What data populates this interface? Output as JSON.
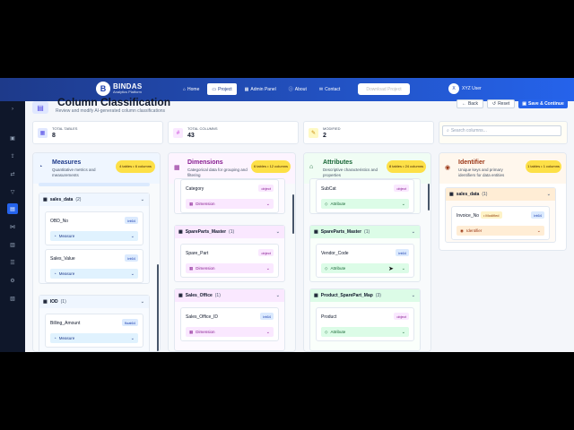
{
  "app": {
    "name": "BINDAS",
    "tagline": "Analytics Platform",
    "logo_letter": "B"
  },
  "nav": [
    {
      "label": "Home",
      "icon": "home-icon",
      "active": false
    },
    {
      "label": "Project",
      "icon": "folder-icon",
      "active": true
    },
    {
      "label": "Admin Panel",
      "icon": "grid-icon",
      "active": false
    },
    {
      "label": "About",
      "icon": "info-icon",
      "active": false
    },
    {
      "label": "Contact",
      "icon": "mail-icon",
      "active": false
    }
  ],
  "download_label": "Download Project",
  "user": {
    "name": "XYZ User",
    "initials": "X"
  },
  "page": {
    "title": "Column Classification",
    "subtitle": "Review and modify AI-generated column classifications"
  },
  "actions": {
    "back": "Back",
    "reset": "Reset",
    "save": "Save & Continue"
  },
  "stats": [
    {
      "label": "TOTAL TABLES",
      "value": "8",
      "icon": "table-icon",
      "color": "#4f46e5",
      "bg": "#e0e7ff"
    },
    {
      "label": "TOTAL COLUMNS",
      "value": "43",
      "icon": "hash-icon",
      "color": "#c026d3",
      "bg": "#fae8ff"
    },
    {
      "label": "MODIFIED",
      "value": "2",
      "icon": "edit-icon",
      "color": "#ca8a04",
      "bg": "#fef9c3"
    }
  ],
  "search": {
    "placeholder": "Search columns..."
  },
  "columns": {
    "measures": {
      "title": "Measures",
      "desc": "Quantitative metrics and measurements",
      "badge": "4 tables • 6 columns",
      "color": "#1e3a8a",
      "bg": "#eff6ff"
    },
    "dimensions": {
      "title": "Dimensions",
      "desc": "Categorical data for grouping and filtering",
      "badge": "6 tables • 12 columns",
      "color": "#86198f",
      "bg": "#fdf4ff"
    },
    "attributes": {
      "title": "Attributes",
      "desc": "Descriptive characteristics and properties",
      "badge": "8 tables • 24 columns",
      "color": "#166534",
      "bg": "#f0fdf4"
    },
    "identifier": {
      "title": "Identifier",
      "desc": "Unique keys and primary identifiers for data entities",
      "badge": "1 tables • 1 columns",
      "color": "#9a3412",
      "bg": "#fff7ed"
    }
  },
  "measures_groups": [
    {
      "name": "sales_data",
      "count": "(2)",
      "items": [
        {
          "name": "OBD_No",
          "dtype": "int64",
          "cls": "Measure"
        },
        {
          "name": "Sales_Value",
          "dtype": "int64",
          "cls": "Measure"
        }
      ]
    },
    {
      "name": "IOD",
      "count": "(1)",
      "items": [
        {
          "name": "Billing_Amount",
          "dtype": "float64",
          "cls": "Measure"
        }
      ]
    }
  ],
  "dimensions_groups": [
    {
      "name": "",
      "count": "",
      "items": [
        {
          "name": "Category",
          "dtype": "object",
          "cls": "Dimension"
        }
      ]
    },
    {
      "name": "SpareParts_Master",
      "count": "(1)",
      "items": [
        {
          "name": "Spare_Part",
          "dtype": "object",
          "cls": "Dimension"
        }
      ]
    },
    {
      "name": "Sales_Office",
      "count": "(1)",
      "items": [
        {
          "name": "Sales_Office_ID",
          "dtype": "int64",
          "cls": "Dimension"
        }
      ]
    }
  ],
  "attributes_groups": [
    {
      "name": "",
      "count": "",
      "items": [
        {
          "name": "SubCat",
          "dtype": "object",
          "cls": "Attribute"
        }
      ]
    },
    {
      "name": "SpareParts_Master",
      "count": "(1)",
      "items": [
        {
          "name": "Vendor_Code",
          "dtype": "int64",
          "cls": "Attribute"
        }
      ]
    },
    {
      "name": "Product_SparePart_Map",
      "count": "(3)",
      "items": [
        {
          "name": "Product",
          "dtype": "object",
          "cls": "Attribute"
        }
      ]
    }
  ],
  "identifier_groups": [
    {
      "name": "sales_data",
      "count": "(1)",
      "items": [
        {
          "name": "Invoice_No",
          "dtype": "int64",
          "cls": "Identifier",
          "modified": "Modified"
        }
      ]
    }
  ]
}
